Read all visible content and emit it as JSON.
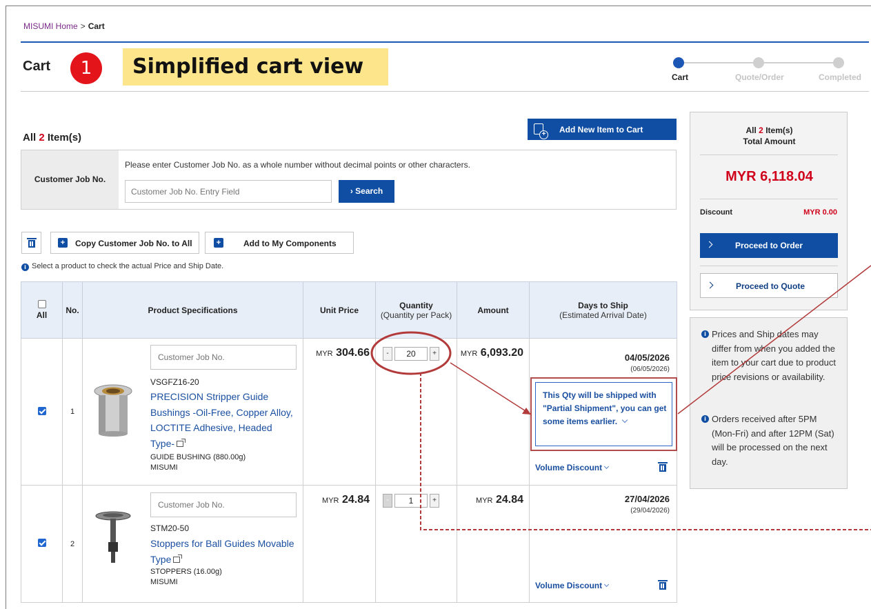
{
  "breadcrumb": {
    "home": "MISUMI Home",
    "separator": ">",
    "current": "Cart"
  },
  "page_title": "Cart",
  "annotation": {
    "number": "1",
    "banner": "Simplified cart view"
  },
  "steps": [
    {
      "label": "Cart"
    },
    {
      "label": "Quote/Order"
    },
    {
      "label": "Completed"
    }
  ],
  "items_header": {
    "prefix": "All",
    "count": "2",
    "suffix": "Item(s)"
  },
  "add_new_label": "Add New Item to Cart",
  "job_no": {
    "label": "Customer Job No.",
    "instruction": "Please enter Customer Job No. as a whole number without decimal points or other characters.",
    "placeholder": "Customer Job No. Entry Field",
    "search_label": "Search"
  },
  "toolbar": {
    "copy_label": "Copy Customer Job No. to All",
    "add_components_label": "Add to My Components"
  },
  "select_note": "Select a product to check the actual Price and Ship Date.",
  "table": {
    "headers": {
      "all": "All",
      "no": "No.",
      "spec": "Product Specifications",
      "unit_price": "Unit Price",
      "qty": "Quantity",
      "qty_sub": "(Quantity per Pack)",
      "amount": "Amount",
      "days": "Days to Ship",
      "days_sub": "(Estimated Arrival Date)"
    },
    "rows": [
      {
        "no": "1",
        "job_placeholder": "Customer Job No.",
        "code": "VSGFZ16-20",
        "name": "PRECISION Stripper Guide Bushings -Oil-Free, Copper Alloy, LOCTITE Adhesive, Headed Type-",
        "category": "GUIDE BUSHING (880.00g)",
        "brand": "MISUMI",
        "currency": "MYR",
        "unit_price": "304.66",
        "minus": "-",
        "qty": "20",
        "plus": "+",
        "amount": "6,093.20",
        "ship_date": "04/05/2026",
        "arrival": "(06/05/2026)",
        "volume_discount": "Volume Discount"
      },
      {
        "no": "2",
        "job_placeholder": "Customer Job No.",
        "code": "STM20-50",
        "name": "Stoppers for Ball Guides Movable Type",
        "category": "STOPPERS (16.00g)",
        "brand": "MISUMI",
        "currency": "MYR",
        "unit_price": "24.84",
        "minus": "-",
        "qty": "1",
        "plus": "+",
        "amount": "24.84",
        "ship_date": "27/04/2026",
        "arrival": "(29/04/2026)",
        "volume_discount": "Volume Discount"
      }
    ]
  },
  "partial_notice": "This Qty will be shipped with \"Partial Shipment\", you can get some items earlier.",
  "summary": {
    "prefix": "All",
    "count": "2",
    "suffix": "Item(s)",
    "total_label": "Total Amount",
    "total": "MYR 6,118.04",
    "discount_label": "Discount",
    "discount": "MYR 0.00",
    "order_label": "Proceed to Order",
    "quote_label": "Proceed to Quote"
  },
  "notes": [
    "Prices and Ship dates may differ from when you added the item to your cart due to product price revisions or availability.",
    "Orders received after 5PM (Mon-Fri) and after 12PM (Sat) will be processed on the next day."
  ],
  "colors": {
    "brand_blue": "#0f4ea2",
    "accent_red": "#d0021b",
    "highlight_yellow": "#fde58b",
    "annotation_red": "#b24b4b"
  }
}
